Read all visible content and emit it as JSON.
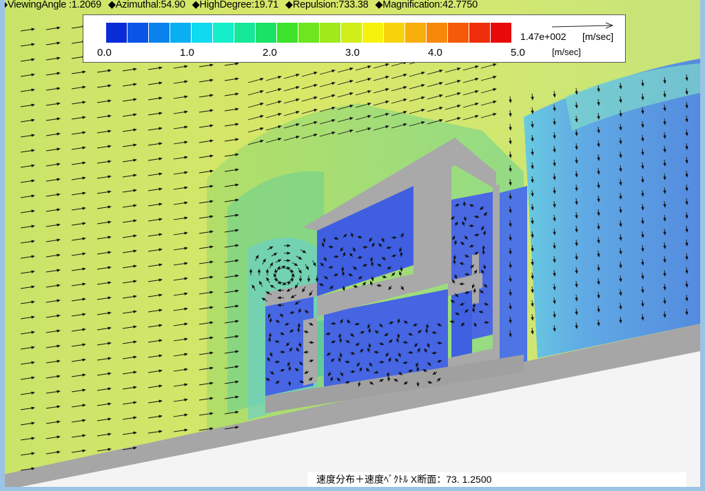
{
  "params": {
    "viewing_angle": "◆ViewingAngle :1.2069",
    "azimuthal": "◆Azimuthal:54.90",
    "high_degree": "◆HighDegree:19.71",
    "repulsion": "◆Repulsion:733.38",
    "magnification": "◆Magnification:42.7750"
  },
  "legend": {
    "ticks": [
      "0.0",
      "1.0",
      "2.0",
      "3.0",
      "4.0",
      "5.0"
    ],
    "unit": "[m/sec]",
    "scale_value": "1.47e+002",
    "scale_unit": "[m/sec]",
    "colors": [
      "#0a2bd8",
      "#0a55e6",
      "#0a82ee",
      "#0aaef2",
      "#0fdaf0",
      "#14eecb",
      "#16e89a",
      "#1ae266",
      "#3ee22a",
      "#6ee61e",
      "#a0ea1c",
      "#d0ee1a",
      "#f6f20e",
      "#f8d30c",
      "#f8ae0a",
      "#f78808",
      "#f45a08",
      "#ee2e0a",
      "#e80a0a"
    ]
  },
  "colors": {
    "far_field": "#d2e66e",
    "wake": "#4f87e6",
    "building_wall": "#a9a9a9",
    "ground_shadow": "#a4a4a4",
    "frame": "#9cc3e6"
  },
  "caption": "速度分布＋速度ﾍﾞｸﾄﾙ X断面：73. 1.2500"
}
